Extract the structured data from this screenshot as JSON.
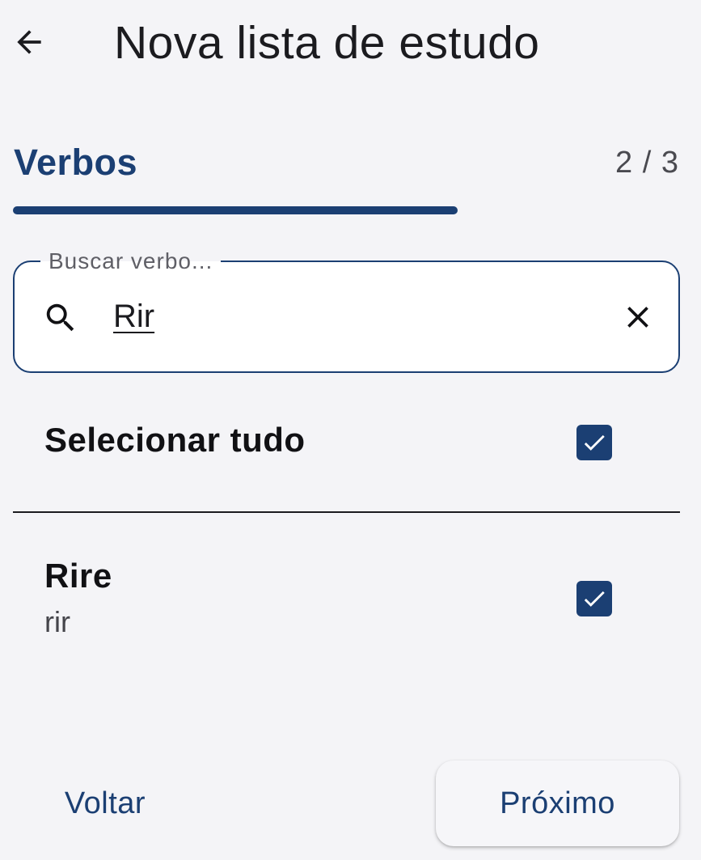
{
  "header": {
    "title": "Nova lista de estudo",
    "back_icon": "arrow-left-icon"
  },
  "step": {
    "title": "Verbos",
    "counter": "2 / 3",
    "progress": 0.667
  },
  "search": {
    "label": "Buscar verbo...",
    "value": "Rir",
    "search_icon": "search-icon",
    "clear_icon": "close-icon"
  },
  "select_all": {
    "label": "Selecionar tudo",
    "checked": true
  },
  "verbs": [
    {
      "name": "Rire",
      "translation": "rir",
      "checked": true
    }
  ],
  "footer": {
    "back_label": "Voltar",
    "next_label": "Próximo"
  },
  "colors": {
    "accent": "#1b3f73",
    "background": "#f4f4f7"
  }
}
